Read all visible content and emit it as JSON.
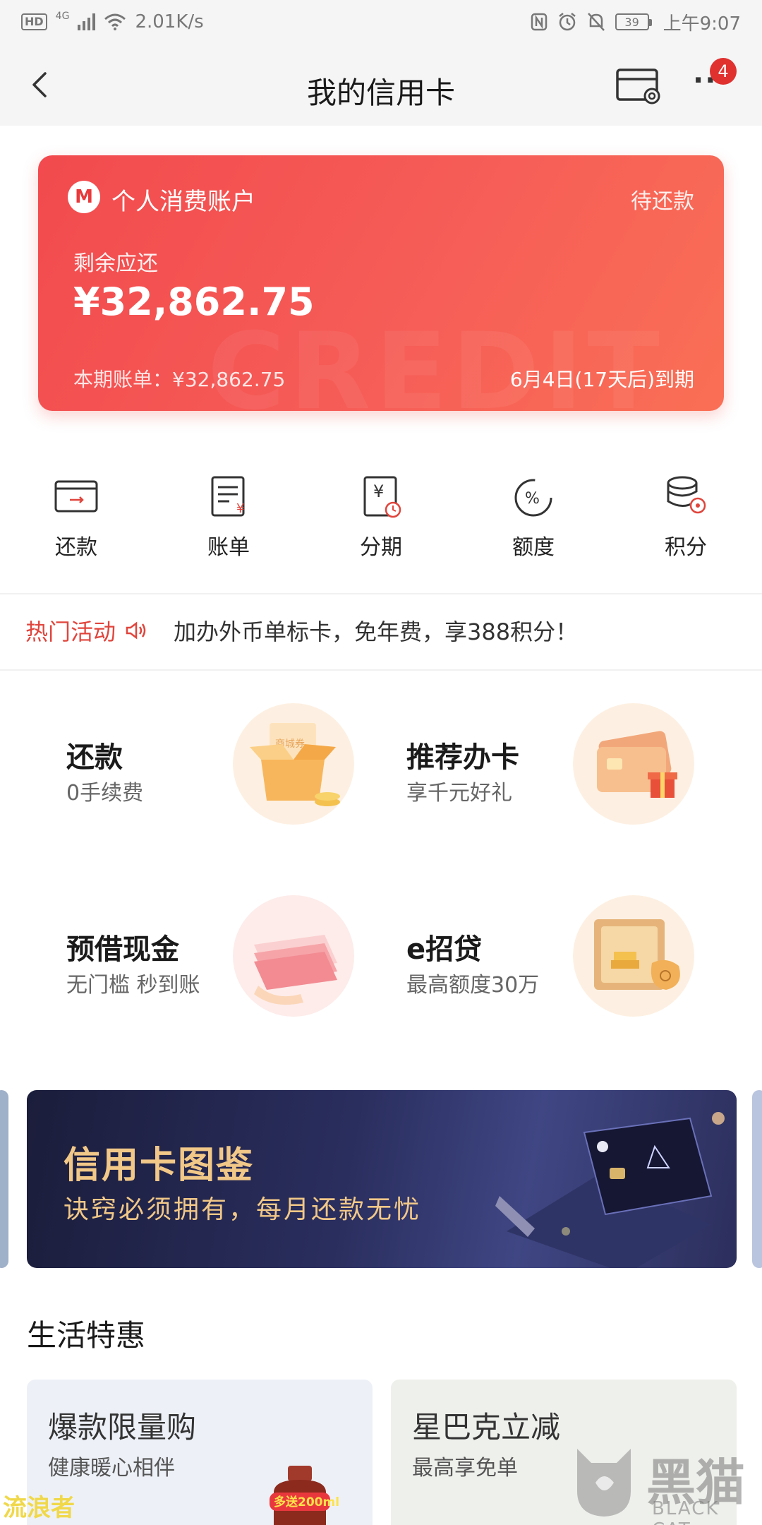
{
  "status_bar": {
    "hd": "HD",
    "network": "4G",
    "speed": "2.01K/s",
    "battery": "39",
    "time": "上午9:07"
  },
  "header": {
    "title": "我的信用卡",
    "badge_count": "4"
  },
  "account_card": {
    "name": "个人消费账户",
    "status": "待还款",
    "remaining_label": "剩余应还",
    "remaining_amount": "¥32,862.75",
    "bill_text": "本期账单：¥32,862.75",
    "due_text": "6月4日(17天后)到期",
    "watermark": "CREDIT"
  },
  "quick_actions": [
    {
      "label": "还款",
      "icon": "repay-card-icon"
    },
    {
      "label": "账单",
      "icon": "bill-icon"
    },
    {
      "label": "分期",
      "icon": "installment-icon"
    },
    {
      "label": "额度",
      "icon": "limit-percent-icon"
    },
    {
      "label": "积分",
      "icon": "points-coins-icon"
    }
  ],
  "hot_activity": {
    "label": "热门活动",
    "text": "加办外币单标卡，免年费，享388积分！"
  },
  "promo_tiles": [
    {
      "title": "还款",
      "subtitle": "0手续费",
      "illu_text": "商城券"
    },
    {
      "title": "推荐办卡",
      "subtitle": "享千元好礼"
    },
    {
      "title": "预借现金",
      "subtitle": "无门槛 秒到账"
    },
    {
      "title": "e招贷",
      "subtitle": "最高额度30万"
    }
  ],
  "banner": {
    "title": "信用卡图鉴",
    "subtitle": "诀窍必须拥有，每月还款无忧"
  },
  "life_section": {
    "title": "生活特惠",
    "cards": [
      {
        "title": "爆款限量购",
        "subtitle": "健康暖心相伴",
        "tag": "多送200ml"
      },
      {
        "title": "星巴克立减",
        "subtitle": "最高享免单"
      }
    ]
  },
  "watermarks": {
    "left": "流浪者",
    "right": "黑猫",
    "right_sub": "BLACK CAT"
  },
  "colors": {
    "accent_red": "#f24a4e",
    "hot_red": "#e0453c",
    "banner_gold": "#f2c888"
  }
}
